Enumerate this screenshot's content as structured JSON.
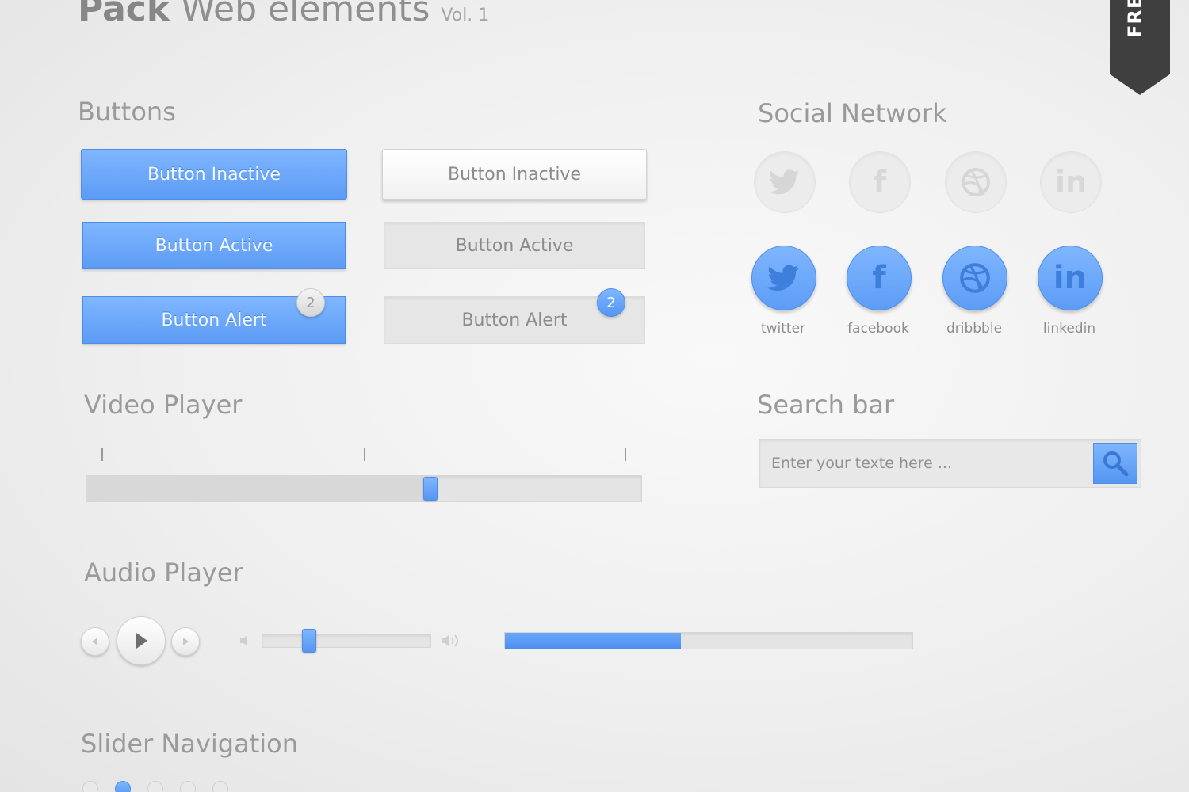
{
  "header": {
    "brand": "Pack",
    "title": "Web elements",
    "version": "Vol. 1",
    "ribbon": "FREE"
  },
  "buttons": {
    "title": "Buttons",
    "blue_inactive": "Button Inactive",
    "blue_active": "Button Active",
    "blue_alert": "Button Alert",
    "blue_alert_count": "2",
    "white_inactive": "Button Inactive",
    "grey_active": "Button Active",
    "grey_alert": "Button Alert",
    "grey_alert_count": "2"
  },
  "social": {
    "title": "Social Network",
    "items": [
      {
        "label": "twitter",
        "glyph": "🐦",
        "icon": "twitter-icon"
      },
      {
        "label": "facebook",
        "glyph": "f",
        "icon": "facebook-icon"
      },
      {
        "label": "dribbble",
        "glyph": "◎",
        "icon": "dribbble-icon"
      },
      {
        "label": "linkedin",
        "glyph": "in",
        "icon": "linkedin-icon"
      }
    ]
  },
  "video": {
    "title": "Video Player",
    "progress": 0.62
  },
  "search": {
    "title": "Search bar",
    "placeholder": "Enter your texte here ..."
  },
  "audio": {
    "title": "Audio Player",
    "volume": 0.28,
    "progress": 0.43
  },
  "slider_nav": {
    "title": "Slider Navigation",
    "count": 5,
    "active_index": 1
  },
  "colors": {
    "accent": "#5c9bf5",
    "accent_dark": "#4f8ee8",
    "ribbon": "#3f3f3f"
  }
}
